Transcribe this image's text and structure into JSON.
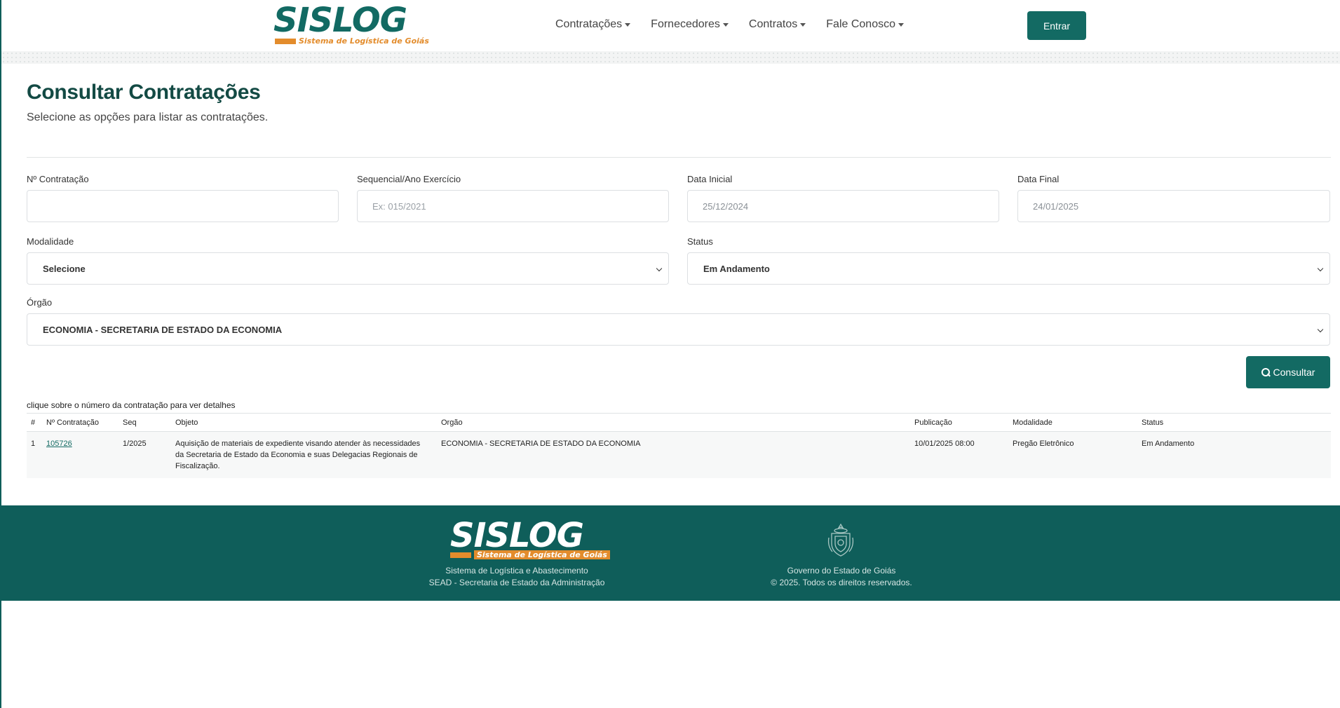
{
  "header": {
    "logo_text": "SISLOG",
    "logo_subtitle": "Sistema de Logística de Goiás",
    "nav": [
      "Contratações",
      "Fornecedores",
      "Contratos",
      "Fale Conosco"
    ],
    "login_button": "Entrar"
  },
  "page": {
    "title": "Consultar Contratações",
    "subtitle": "Selecione as opções para listar as contratações."
  },
  "form": {
    "num_contratacao_label": "Nº Contratação",
    "num_contratacao_value": "",
    "sequencial_label": "Sequencial/Ano Exercício",
    "sequencial_placeholder": "Ex: 015/2021",
    "data_inicial_label": "Data Inicial",
    "data_inicial_value": "25/12/2024",
    "data_final_label": "Data Final",
    "data_final_value": "24/01/2025",
    "modalidade_label": "Modalidade",
    "modalidade_value": "Selecione",
    "status_label": "Status",
    "status_value": "Em Andamento",
    "orgao_label": "Órgão",
    "orgao_value": "ECONOMIA - SECRETARIA DE ESTADO DA ECONOMIA",
    "submit_label": "Consultar"
  },
  "results": {
    "hint": "clique sobre o número da contratação para ver detalhes",
    "columns": [
      "#",
      "Nº Contratação",
      "Seq",
      "Objeto",
      "Orgão",
      "Publicação",
      "Modalidade",
      "Status"
    ],
    "rows": [
      {
        "index": "1",
        "numero": "105726",
        "seq": "1/2025",
        "objeto": "Aquisição de materiais de expediente visando atender às necessidades da Secretaria de Estado da Economia e suas Delegacias Regionais de Fiscalização.",
        "orgao": "ECONOMIA - SECRETARIA DE ESTADO DA ECONOMIA",
        "publicacao": "10/01/2025 08:00",
        "modalidade": "Pregão Eletrônico",
        "status": "Em Andamento"
      }
    ]
  },
  "footer": {
    "logo_text": "SISLOG",
    "logo_subtitle": "Sistema de Logística de Goiás",
    "line1": "Sistema de Logística e Abastecimento",
    "line2": "SEAD - Secretaria de Estado da Administração",
    "gov_line1": "Governo do Estado de Goiás",
    "gov_line2": "© 2025. Todos os direitos reservados."
  },
  "colors": {
    "brand": "#136a63",
    "accent": "#e38c2c",
    "footer_bg": "#0f5e5a"
  }
}
